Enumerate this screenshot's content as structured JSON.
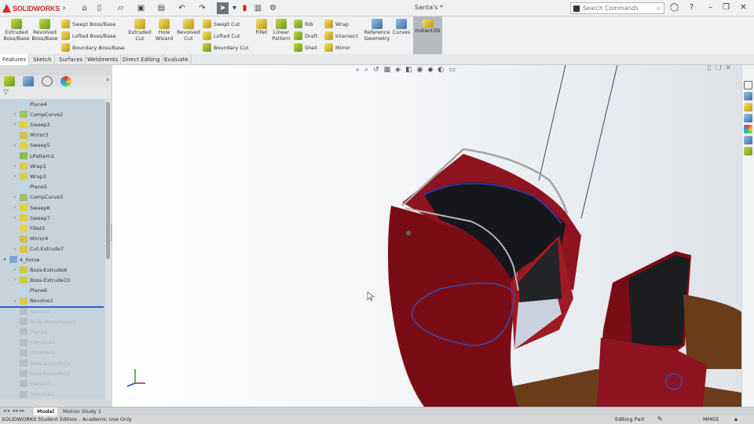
{
  "app": {
    "logo": "SOLIDWORKS",
    "title": "Santa's *"
  },
  "search": {
    "placeholder": "Search Commands"
  },
  "ribbon": {
    "big": [
      {
        "label": "Extruded Boss/Base"
      },
      {
        "label": "Revolved Boss/Base"
      },
      {
        "label": "Extruded Cut"
      },
      {
        "label": "Hole Wizard"
      },
      {
        "label": "Revolved Cut"
      },
      {
        "label": "Fillet"
      },
      {
        "label": "Linear Pattern"
      },
      {
        "label": "Reference Geometry"
      },
      {
        "label": "Curves"
      },
      {
        "label": "Instant3D"
      }
    ],
    "small": [
      {
        "label": "Swept Boss/Base"
      },
      {
        "label": "Lofted Boss/Base"
      },
      {
        "label": "Boundary Boss/Base"
      },
      {
        "label": "Swept Cut"
      },
      {
        "label": "Lofted Cut"
      },
      {
        "label": "Boundary Cut"
      },
      {
        "label": "Rib"
      },
      {
        "label": "Draft"
      },
      {
        "label": "Shell"
      },
      {
        "label": "Wrap"
      },
      {
        "label": "Intersect"
      },
      {
        "label": "Mirror"
      }
    ]
  },
  "tabs": [
    {
      "label": "Features"
    },
    {
      "label": "Sketch"
    },
    {
      "label": "Surfaces"
    },
    {
      "label": "Weldments"
    },
    {
      "label": "Direct Editing"
    },
    {
      "label": "Evaluate"
    }
  ],
  "tree": [
    {
      "label": "Plane4",
      "icon": "plane",
      "exp": false
    },
    {
      "label": "CompCurve2",
      "icon": "curve",
      "exp": true
    },
    {
      "label": "Sweep3",
      "icon": "sweep",
      "exp": true
    },
    {
      "label": "Mirror3",
      "icon": "mirror",
      "exp": false
    },
    {
      "label": "Sweep5",
      "icon": "sweep",
      "exp": true
    },
    {
      "label": "LPattern1",
      "icon": "pattern",
      "exp": false
    },
    {
      "label": "Wrap1",
      "icon": "wrap",
      "exp": true
    },
    {
      "label": "Wrap3",
      "icon": "wrap",
      "exp": true
    },
    {
      "label": "Plane5",
      "icon": "plane",
      "exp": false
    },
    {
      "label": "CompCurve3",
      "icon": "curve",
      "exp": true
    },
    {
      "label": "Sweep6",
      "icon": "sweep",
      "exp": true
    },
    {
      "label": "Sweep7",
      "icon": "sweep",
      "exp": true
    },
    {
      "label": "Fillet5",
      "icon": "fillet",
      "exp": false
    },
    {
      "label": "Mirror4",
      "icon": "mirror",
      "exp": false
    },
    {
      "label": "Cut-Extrude7",
      "icon": "cut",
      "exp": true
    },
    {
      "label": "4_horse",
      "icon": "folder",
      "exp": true,
      "folder": true
    },
    {
      "label": "Boss-Extrude9",
      "icon": "boss",
      "exp": true,
      "indent": true
    },
    {
      "label": "Boss-Extrude10",
      "icon": "boss",
      "exp": true,
      "indent": true
    },
    {
      "label": "Plane6",
      "icon": "plane",
      "indent": true
    },
    {
      "label": "Revolve1",
      "icon": "revolve",
      "exp": true,
      "indent": true
    },
    {
      "label": "Revolve",
      "sup": true
    },
    {
      "label": "Body-Move/Copy1",
      "sup": true
    },
    {
      "label": "Plane9",
      "sup": true
    },
    {
      "label": "Combine1",
      "sup": true
    },
    {
      "label": "Chamfer1",
      "sup": true
    },
    {
      "label": "Boss-Extrude11",
      "sup": true
    },
    {
      "label": "Boss-Extrude12",
      "sup": true
    },
    {
      "label": "Plane10",
      "sup": true
    },
    {
      "label": "Sketch51",
      "sup": true
    }
  ],
  "bottom_tabs": [
    {
      "label": "Model"
    },
    {
      "label": "Motion Study 1"
    }
  ],
  "status": {
    "left": "SOLIDWORKS Student Edition - Academic Use Only",
    "mode": "Editing Part",
    "units": "MMGS"
  },
  "colors": {
    "body_red": "#7a0c16",
    "body_red_light": "#9e1a24",
    "tree_bg": "#c7d3dc",
    "rollback": "#2e5fd2"
  }
}
